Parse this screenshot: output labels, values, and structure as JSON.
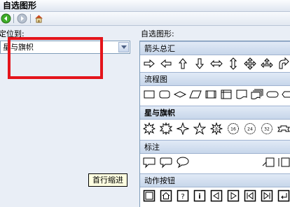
{
  "window": {
    "title": "自选图形"
  },
  "left": {
    "label": "定位到:",
    "select_value": "星与旗帜"
  },
  "right": {
    "label": "自选图形:"
  },
  "categories": [
    "箭头总汇",
    "流程图",
    "星与旗帜",
    "标注",
    "动作按钮"
  ],
  "tooltip": "首行缩进",
  "colors": {
    "highlight_box": "#e4141b",
    "category_bg": "#c7d6ea"
  },
  "icons": {
    "toolbar": [
      "back-icon",
      "forward-icon",
      "home-icon"
    ],
    "arrows": [
      "arrow-right-icon",
      "arrow-left-icon",
      "arrow-up-icon",
      "arrow-down-icon",
      "arrow-left-right-icon",
      "arrow-up-down-icon",
      "arrow-quad-icon",
      "arrow-left-right-up-icon",
      "arrow-curved-icon"
    ],
    "flowchart": [
      "flowchart-process-icon",
      "flowchart-alternate-process-icon",
      "flowchart-decision-icon",
      "flowchart-data-icon",
      "flowchart-predefined-process-icon",
      "flowchart-internal-storage-icon",
      "flowchart-document-icon",
      "flowchart-multidocument-icon",
      "flowchart-terminator-icon",
      "flowchart-preparation-icon"
    ],
    "stars": [
      "explosion1-icon",
      "explosion2-icon",
      "star4-icon",
      "star5-icon",
      "star8-icon",
      "star16-icon",
      "star24-icon",
      "star32-icon",
      "ribbon-icon"
    ],
    "callouts": [
      "rectangular-callout-icon",
      "rounded-callout-icon",
      "oval-callout-icon",
      "line-callout-icon",
      "line-callout2-icon"
    ],
    "action_buttons": [
      "action-custom-icon",
      "action-home-icon",
      "action-help-icon",
      "action-information-icon",
      "action-back-icon",
      "action-forward-icon",
      "action-beginning-icon",
      "action-end-icon",
      "action-return-icon",
      "action-document-icon"
    ]
  }
}
